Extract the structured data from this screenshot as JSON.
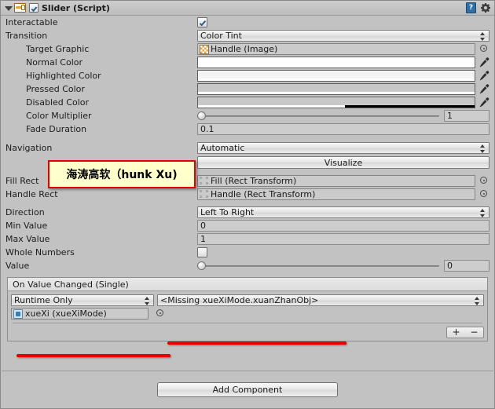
{
  "header": {
    "title": "Slider (Script)",
    "enabled_checkbox": true,
    "component_icon": "slider-icon",
    "help_icon": "?",
    "gear_icon": "gear-icon"
  },
  "properties": {
    "interactable": {
      "label": "Interactable",
      "value": true
    },
    "transition": {
      "label": "Transition",
      "value": "Color Tint"
    },
    "target_graphic": {
      "label": "Target Graphic",
      "value": "Handle (Image)"
    },
    "normal_color": {
      "label": "Normal Color",
      "color": "#ffffff",
      "alpha": 100
    },
    "highlighted_color": {
      "label": "Highlighted Color",
      "color": "#f5f5f5",
      "alpha": 100
    },
    "pressed_color": {
      "label": "Pressed Color",
      "color": "#c8c8c8",
      "alpha": 100
    },
    "disabled_color": {
      "label": "Disabled Color",
      "color": "#c8c8c8",
      "alpha": 50
    },
    "color_multiplier": {
      "label": "Color Multiplier",
      "value": "1",
      "slider_pct": 0
    },
    "fade_duration": {
      "label": "Fade Duration",
      "value": "0.1"
    },
    "navigation": {
      "label": "Navigation",
      "value": "Automatic"
    },
    "visualize": {
      "label": "Visualize"
    },
    "fill_rect": {
      "label": "Fill Rect",
      "value": "Fill (Rect Transform)"
    },
    "handle_rect": {
      "label": "Handle Rect",
      "value": "Handle (Rect Transform)"
    },
    "direction": {
      "label": "Direction",
      "value": "Left To Right"
    },
    "min_value": {
      "label": "Min Value",
      "value": "0"
    },
    "max_value": {
      "label": "Max Value",
      "value": "1"
    },
    "whole_numbers": {
      "label": "Whole Numbers",
      "value": false
    },
    "value": {
      "label": "Value",
      "value": "0",
      "slider_pct": 0
    }
  },
  "event": {
    "title": "On Value Changed (Single)",
    "call_mode": "Runtime Only",
    "function": "<Missing xueXiMode.xuanZhanObj>",
    "object": "xueXi (xueXiMode)",
    "add_label": "+",
    "remove_label": "−"
  },
  "footer": {
    "add_component": "Add Component"
  },
  "annotation": {
    "text": "海涛高软（hunk Xu)",
    "box_color": "#ffffcc",
    "border_color": "#e60000",
    "underline_color": "#e60000"
  }
}
